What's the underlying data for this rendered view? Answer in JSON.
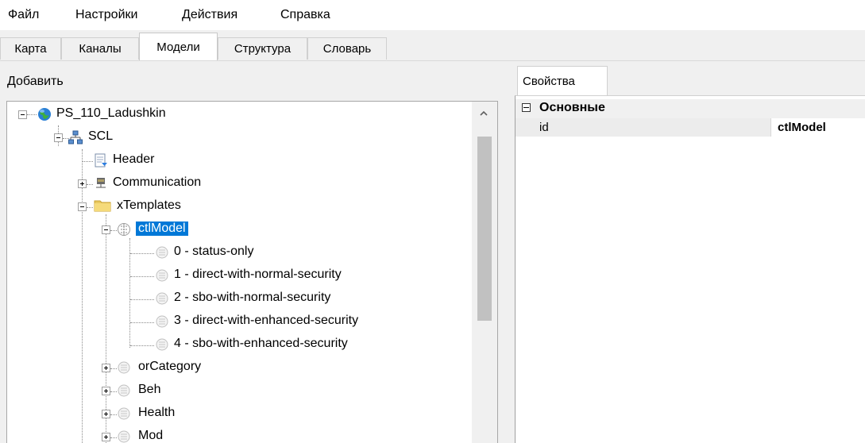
{
  "menu": {
    "items": [
      "Файл",
      "Настройки",
      "Действия",
      "Справка"
    ]
  },
  "tabs": [
    "Карта",
    "Каналы",
    "Модели",
    "Структура",
    "Словарь"
  ],
  "active_tab": "Модели",
  "left_panel": {
    "toolbar_label": "Добавить"
  },
  "tree": {
    "root": "PS_110_Ladushkin",
    "scl": "SCL",
    "header": "Header",
    "communication": "Communication",
    "templates": "xTemplates",
    "selected": "ctlModel",
    "enum_values": [
      "0 - status-only",
      "1 - direct-with-normal-security",
      "2 - sbo-with-normal-security",
      "3 - direct-with-enhanced-security",
      "4 - sbo-with-enhanced-security"
    ],
    "siblings": [
      "orCategory",
      "Beh",
      "Health",
      "Mod"
    ]
  },
  "properties": {
    "tab_label": "Свойства",
    "category": "Основные",
    "rows": [
      {
        "name": "id",
        "value": "ctlModel"
      }
    ]
  },
  "colors": {
    "selection": "#0078d7",
    "globe": "#2a7fd4",
    "folder": "#e8c860"
  }
}
